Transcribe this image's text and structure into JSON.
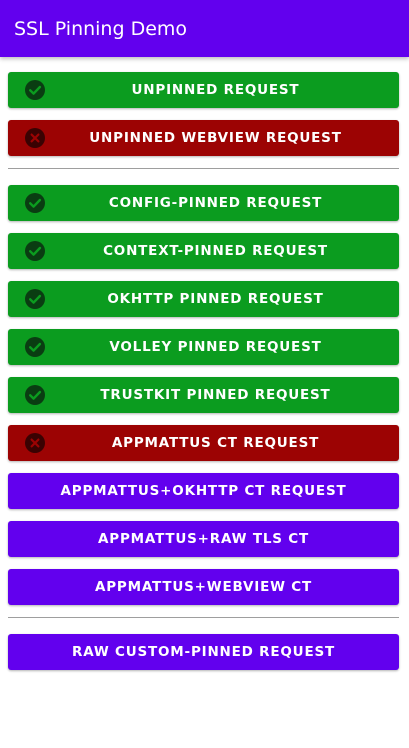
{
  "app": {
    "title": "SSL Pinning Demo"
  },
  "colors": {
    "app_bar": "#6200ee",
    "success": "#0b9c1f",
    "failure": "#9c0303",
    "default": "#6200ee",
    "text": "#ffffff"
  },
  "buttons": [
    {
      "label": "UNPINNED REQUEST",
      "status": "success",
      "icon": "check-circle-icon"
    },
    {
      "label": "UNPINNED WEBVIEW REQUEST",
      "status": "failure",
      "icon": "x-circle-icon"
    },
    {
      "label": "CONFIG-PINNED REQUEST",
      "status": "success",
      "icon": "check-circle-icon"
    },
    {
      "label": "CONTEXT-PINNED REQUEST",
      "status": "success",
      "icon": "check-circle-icon"
    },
    {
      "label": "OKHTTP PINNED REQUEST",
      "status": "success",
      "icon": "check-circle-icon"
    },
    {
      "label": "VOLLEY PINNED REQUEST",
      "status": "success",
      "icon": "check-circle-icon"
    },
    {
      "label": "TRUSTKIT PINNED REQUEST",
      "status": "success",
      "icon": "check-circle-icon"
    },
    {
      "label": "APPMATTUS CT REQUEST",
      "status": "failure",
      "icon": "x-circle-icon"
    },
    {
      "label": "APPMATTUS+OKHTTP CT REQUEST",
      "status": "none"
    },
    {
      "label": "APPMATTUS+RAW TLS CT",
      "status": "none"
    },
    {
      "label": "APPMATTUS+WEBVIEW CT",
      "status": "none"
    },
    {
      "label": "RAW CUSTOM-PINNED REQUEST",
      "status": "none"
    }
  ]
}
